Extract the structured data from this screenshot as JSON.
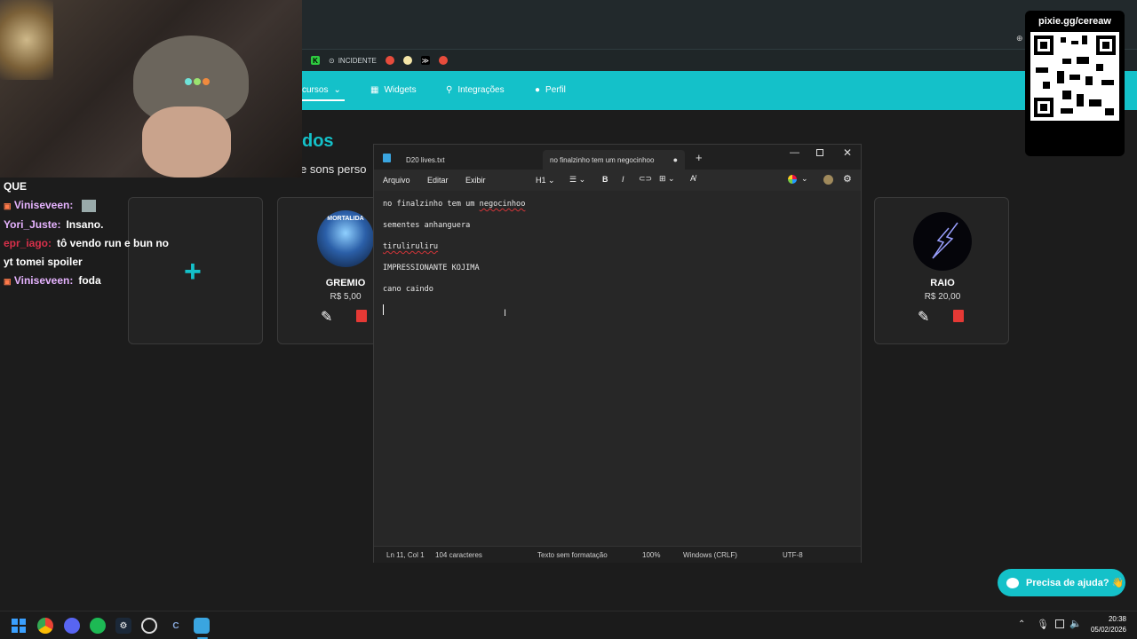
{
  "browser": {
    "bookmarks": [
      {
        "label": "",
        "color": "#2ecc40"
      },
      {
        "label": "INCIDENTE",
        "color": "#888"
      },
      {
        "label": "",
        "color": "#e74c3c"
      },
      {
        "label": "",
        "color": "#f5e6a8"
      },
      {
        "label": "≫",
        "color": "#000"
      },
      {
        "label": "",
        "color": "#e74c3c"
      }
    ],
    "nav": {
      "recursos": "cursos",
      "widgets": "Widgets",
      "integracoes": "Integrações",
      "perfil": "Perfil"
    },
    "heading": "dos",
    "subheading": "e sons perso",
    "cards": [
      {
        "title": "GREMIO",
        "price": "R$ 5,00",
        "thumb_text": "MORTALIDA"
      },
      {
        "title": "RAIO",
        "price": "R$ 20,00"
      }
    ],
    "help_button": "Precisa de ajuda? 👋",
    "accent": "#14c1c9"
  },
  "overlay": {
    "qr_label": "pixie.gg/cereaw",
    "chat": [
      {
        "user": "",
        "text": "QUE",
        "color": "#ffffff"
      },
      {
        "user": "Viniseveen:",
        "text": "",
        "color": "#e6b3ff",
        "badge": true,
        "emote": true
      },
      {
        "user": "Yori_Juste:",
        "text": "Insano.",
        "color": "#e6b3ff"
      },
      {
        "user": "epr_iago:",
        "text": "tô vendo run e bun no",
        "color": "#d9304a"
      },
      {
        "user": "",
        "text": "yt tomei spoiler",
        "color": "#ffffff"
      },
      {
        "user": "Viniseveen:",
        "text": "foda",
        "color": "#e6b3ff",
        "badge": true
      }
    ]
  },
  "notepad": {
    "tabs": [
      {
        "label": "D20 lives.txt"
      },
      {
        "label": "no finalzinho tem um negocinhoo"
      }
    ],
    "menu": [
      "Arquivo",
      "Editar",
      "Exibir"
    ],
    "heading_select": "H1",
    "lines": [
      {
        "text": "no finalzinho tem um ",
        "squiggle": "negocinhoo"
      },
      {
        "text": "sementes anhanguera"
      },
      {
        "text": "",
        "squiggle": "tiruliruliru"
      },
      {
        "text": "IMPRESSIONANTE KOJIMA"
      },
      {
        "text": "cano caindo"
      }
    ],
    "status": {
      "position": "Ln 11, Col 1",
      "chars": "104 caracteres",
      "format": "Texto sem formatação",
      "zoom": "100%",
      "line_ending": "Windows (CRLF)",
      "encoding": "UTF-8"
    }
  },
  "taskbar": {
    "time": "20:38",
    "date": "05/02/2026",
    "apps": [
      "windows-start",
      "chrome",
      "discord",
      "spotify",
      "steam",
      "obs",
      "ccleaner",
      "notepad"
    ]
  }
}
